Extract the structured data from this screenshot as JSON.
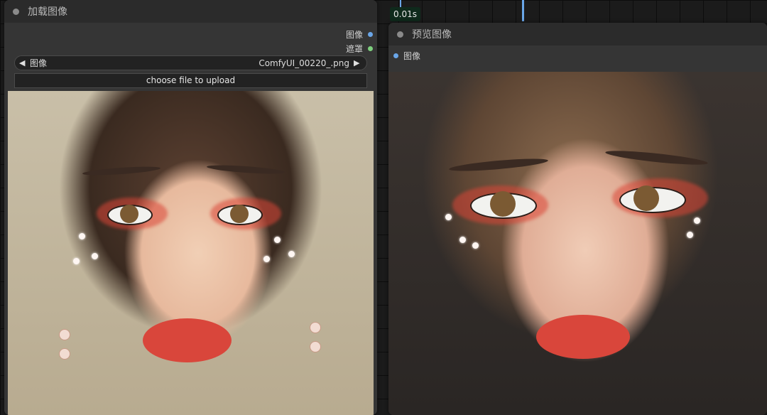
{
  "exec_time": "0.01s",
  "load_node": {
    "title": "加载图像",
    "outputs": [
      {
        "label": "图像",
        "color": "#6aa6e8"
      },
      {
        "label": "遮罩",
        "color": "#7ed07e"
      }
    ],
    "image_combo": {
      "label": "图像",
      "value": "ComfyUI_00220_.png"
    },
    "upload_label": "choose file to upload"
  },
  "preview_node": {
    "title": "预览图像",
    "input_label": "图像"
  }
}
